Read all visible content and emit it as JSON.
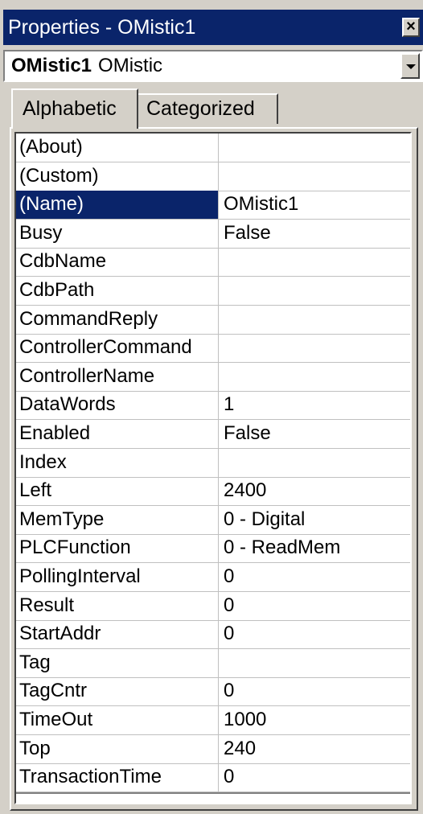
{
  "window": {
    "title": "Properties - OMistic1",
    "close_label": "×"
  },
  "object_selector": {
    "name": "OMistic1",
    "type": "OMistic"
  },
  "tabs": [
    {
      "label": "Alphabetic",
      "active": true
    },
    {
      "label": "Categorized",
      "active": false
    }
  ],
  "properties": [
    {
      "name": "(About)",
      "value": ""
    },
    {
      "name": "(Custom)",
      "value": ""
    },
    {
      "name": "(Name)",
      "value": "OMistic1",
      "selected": true
    },
    {
      "name": "Busy",
      "value": "False"
    },
    {
      "name": "CdbName",
      "value": ""
    },
    {
      "name": "CdbPath",
      "value": ""
    },
    {
      "name": "CommandReply",
      "value": ""
    },
    {
      "name": "ControllerCommand",
      "value": ""
    },
    {
      "name": "ControllerName",
      "value": ""
    },
    {
      "name": "DataWords",
      "value": "1"
    },
    {
      "name": "Enabled",
      "value": "False"
    },
    {
      "name": "Index",
      "value": ""
    },
    {
      "name": "Left",
      "value": "2400"
    },
    {
      "name": "MemType",
      "value": "0 - Digital"
    },
    {
      "name": "PLCFunction",
      "value": "0 - ReadMem"
    },
    {
      "name": "PollingInterval",
      "value": "0"
    },
    {
      "name": "Result",
      "value": "0"
    },
    {
      "name": "StartAddr",
      "value": "0"
    },
    {
      "name": "Tag",
      "value": ""
    },
    {
      "name": "TagCntr",
      "value": "0"
    },
    {
      "name": "TimeOut",
      "value": "1000"
    },
    {
      "name": "Top",
      "value": "240"
    },
    {
      "name": "TransactionTime",
      "value": "0"
    }
  ],
  "colors": {
    "title_bar": "#0a246a",
    "face": "#d4d0c8",
    "selection": "#0a246a"
  }
}
